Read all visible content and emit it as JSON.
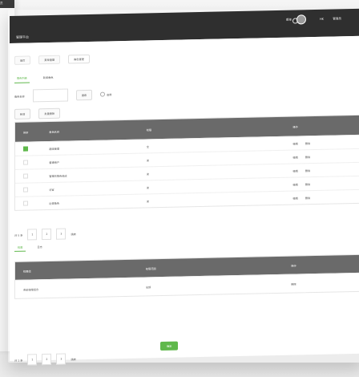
{
  "left_panel": {
    "title": "员"
  },
  "topbar": {
    "app_title": "管理平台",
    "menu_label": "菜单",
    "user_label": "HK",
    "user_label_2": "管理员"
  },
  "breadcrumb": {
    "items": [
      "首页",
      "菜单管理",
      "角色管理"
    ]
  },
  "tabs": [
    "角色列表",
    "新增角色"
  ],
  "filter": {
    "label": "角色名称",
    "input_value": "",
    "search": "搜索",
    "radio_label": "启用"
  },
  "actions": [
    "新增",
    "批量删除"
  ],
  "table": {
    "headers": [
      "排序",
      "角色名称",
      "权限",
      "操作"
    ],
    "rows": [
      {
        "sort_state": "green",
        "name": "超级管理",
        "perm": "全",
        "ops": [
          "编辑",
          "删除"
        ]
      },
      {
        "sort_state": "blank",
        "name": "普通用户",
        "perm": "读",
        "ops": [
          "编辑",
          "删除"
        ]
      },
      {
        "sort_state": "blank",
        "name": "管理员角色组成",
        "perm": "读",
        "ops": [
          "编辑",
          "删除"
        ]
      },
      {
        "sort_state": "blank",
        "name": "访客",
        "perm": "读",
        "ops": [
          "编辑",
          "删除"
        ]
      },
      {
        "sort_state": "blank",
        "name": "运营角色",
        "perm": "读",
        "ops": [
          "编辑",
          "删除"
        ]
      }
    ]
  },
  "pager": {
    "label": "共 5 条",
    "pages": [
      "1",
      "2",
      "3"
    ],
    "go": "跳转"
  },
  "subtabs": [
    "权限",
    "日志"
  ],
  "subtable": {
    "headers": [
      "权限组",
      "权限范围",
      "操作"
    ],
    "row": {
      "group": "系统权限组合",
      "scope": "全部",
      "op": "删除"
    }
  },
  "confirm": "确定",
  "pager2": {
    "label": "共 1 条",
    "pages": [
      "1",
      "2",
      "3"
    ],
    "go": "跳转"
  }
}
